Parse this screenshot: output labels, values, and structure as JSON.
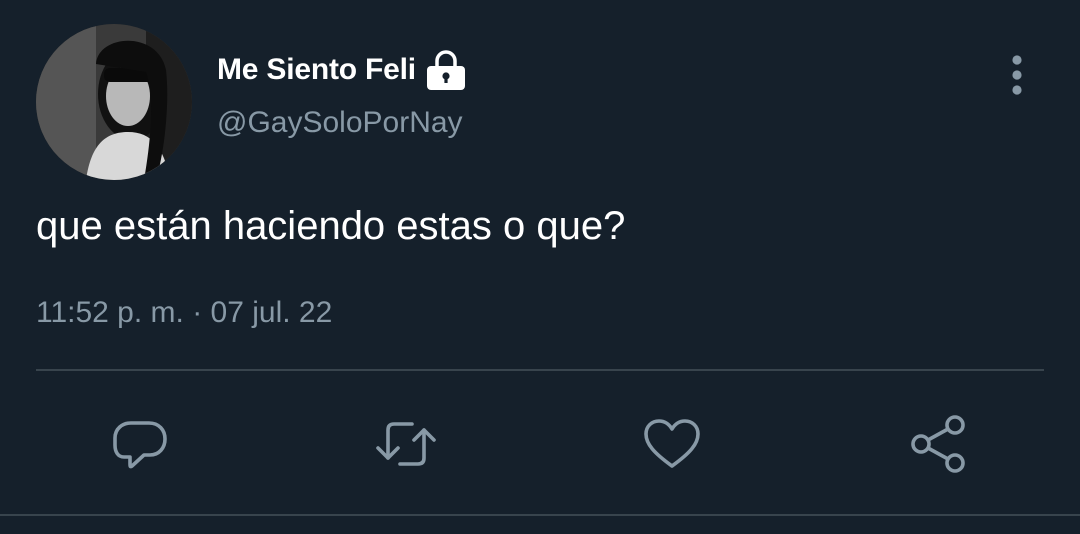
{
  "tweet": {
    "display_name": "Me Siento Feli",
    "handle": "@GaySoloPorNay",
    "text": "que están haciendo estas o que?",
    "timestamp": "11:52 p. m. · 07 jul. 22",
    "protected_icon": "lock-icon",
    "more_icon": "more-vertical-icon"
  },
  "actions": {
    "reply_icon": "reply-icon",
    "retweet_icon": "retweet-icon",
    "like_icon": "heart-icon",
    "share_icon": "share-icon"
  },
  "colors": {
    "background": "#15202b",
    "secondary_text": "#8899a6",
    "divider": "#38444d"
  }
}
